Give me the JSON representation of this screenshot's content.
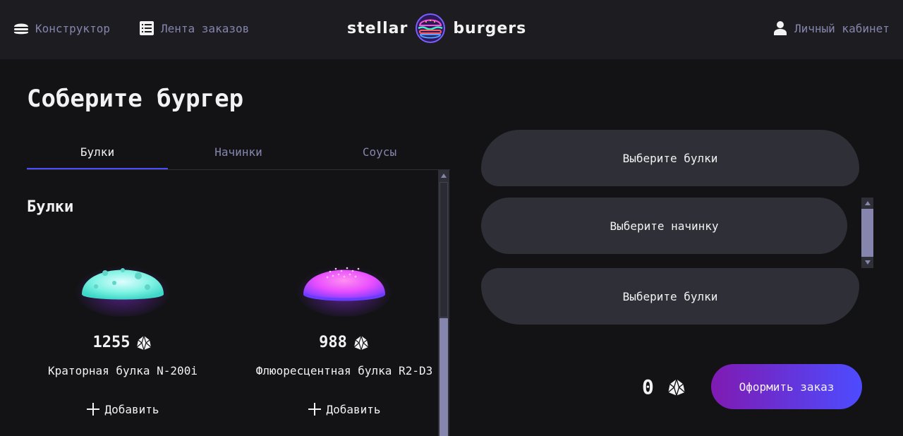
{
  "header": {
    "nav": [
      {
        "label": "Конструктор",
        "icon": "burger-icon"
      },
      {
        "label": "Лента заказов",
        "icon": "list-icon"
      }
    ],
    "logo": {
      "left": "stellar",
      "right": "burgers",
      "icon": "burger-logo-icon"
    },
    "account": {
      "label": "Личный кабинет",
      "icon": "profile-icon"
    }
  },
  "main": {
    "title": "Соберите бургер",
    "tabs": [
      {
        "label": "Булки",
        "active": true
      },
      {
        "label": "Начинки",
        "active": false
      },
      {
        "label": "Соусы",
        "active": false
      }
    ],
    "section_title": "Булки",
    "ingredients": [
      {
        "price": "1255",
        "name": "Краторная булка N-200i",
        "add_label": "Добавить",
        "color": "#7ff3e3"
      },
      {
        "price": "988",
        "name": "Флюоресцентная булка R2-D3",
        "add_label": "Добавить",
        "color": "#e84dff"
      }
    ]
  },
  "constructor": {
    "top_bun": "Выберите булки",
    "filling": "Выберите начинку",
    "bottom_bun": "Выберите булки",
    "total": "0",
    "order_button": "Оформить заказ",
    "currency_icon": "currency-icon"
  },
  "colors": {
    "background": "#131316",
    "header": "#1c1c21",
    "accent": "#4c4cff",
    "inactive_text": "#8585ad",
    "slot": "#2f2f37",
    "order_gradient_start": "#801ab2",
    "order_gradient_end": "#4c4cff"
  }
}
